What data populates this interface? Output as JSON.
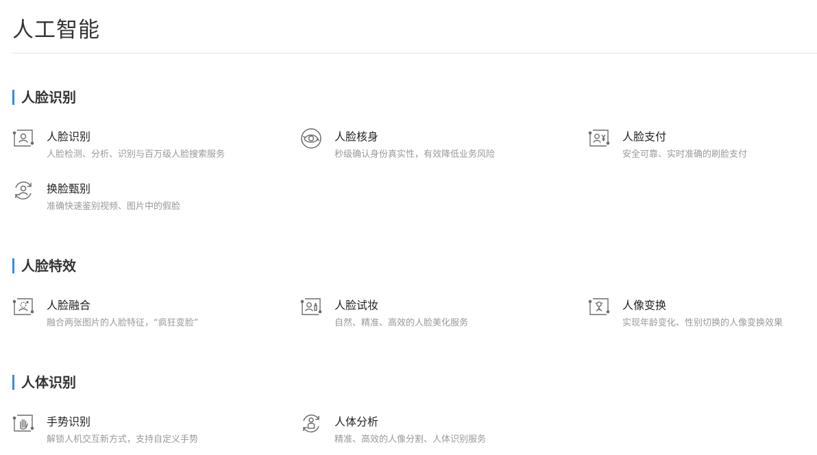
{
  "page": {
    "title": "人工智能"
  },
  "accent_color": "#2d8cf0",
  "icon_color": "#6b6b6b",
  "sections": [
    {
      "title": "人脸识别",
      "items": [
        {
          "name": "人脸识别",
          "desc": "人脸检测、分析、识别与百万级人脸搜索服务",
          "icon": "face-frame-icon"
        },
        {
          "name": "人脸核身",
          "desc": "秒级确认身份真实性，有效降低业务风险",
          "icon": "face-verify-icon"
        },
        {
          "name": "人脸支付",
          "desc": "安全可靠、实时准确的刷脸支付",
          "icon": "face-pay-icon"
        },
        {
          "name": "换脸甄别",
          "desc": "准确快速鉴别视频、图片中的假脸",
          "icon": "face-swap-detect-icon"
        }
      ]
    },
    {
      "title": "人脸特效",
      "items": [
        {
          "name": "人脸融合",
          "desc": "融合两张图片的人脸特征，“疯狂变脸”",
          "icon": "face-fusion-icon"
        },
        {
          "name": "人脸试妆",
          "desc": "自然、精准、高效的人脸美化服务",
          "icon": "face-makeup-icon"
        },
        {
          "name": "人像变换",
          "desc": "实现年龄变化、性别切换的人像变换效果",
          "icon": "portrait-transform-icon"
        }
      ]
    },
    {
      "title": "人体识别",
      "items": [
        {
          "name": "手势识别",
          "desc": "解锁人机交互新方式，支持自定义手势",
          "icon": "gesture-icon"
        },
        {
          "name": "人体分析",
          "desc": "精准、高效的人像分割、人体识别服务",
          "icon": "body-analysis-icon"
        }
      ]
    }
  ]
}
